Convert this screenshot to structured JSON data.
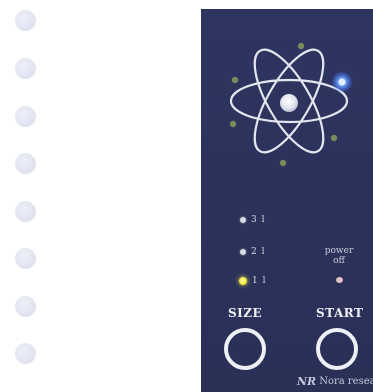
{
  "side_dots": {
    "count": 8
  },
  "panel": {
    "leds": [
      {
        "label": "3 l",
        "lit": false
      },
      {
        "label": "2 l",
        "lit": false
      },
      {
        "label": "1 l",
        "lit": true
      }
    ],
    "power_label": "power off",
    "size_label": "SIZE",
    "start_label": "START",
    "brand": {
      "logo": "NR",
      "text": "Nora researc"
    }
  },
  "colors": {
    "panel": "#2d335d",
    "ring": "#eef0f6",
    "active_led": "#f5ea40",
    "blue_light": "#4a86ff"
  },
  "icons": [
    "atom-icon",
    "circle-dot-icon"
  ]
}
